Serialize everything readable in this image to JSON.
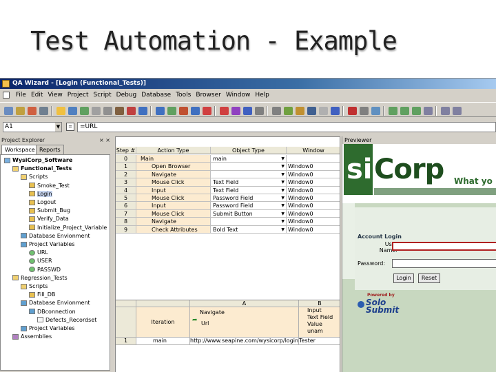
{
  "slide": {
    "title": "Test Automation - Example"
  },
  "window": {
    "title": "QA Wizard - [Login (Functional_Tests)]"
  },
  "menu": [
    "File",
    "Edit",
    "View",
    "Project",
    "Script",
    "Debug",
    "Database",
    "Tools",
    "Browser",
    "Window",
    "Help"
  ],
  "cellbar": {
    "cell_ref": "A1",
    "formula": "=URL",
    "fx": "=",
    "drop": "▼"
  },
  "explorer": {
    "title": "Project Explorer",
    "close": "× ×",
    "tabs": [
      "Workspace",
      "Reports"
    ],
    "nodes": [
      {
        "label": "WysiCorp_Software",
        "icon": "proj",
        "indent": 0,
        "bold": true
      },
      {
        "label": "Functional_Tests",
        "icon": "folder",
        "indent": 1,
        "bold": true
      },
      {
        "label": "Scripts",
        "icon": "folder",
        "indent": 2
      },
      {
        "label": "Smoke_Test",
        "icon": "script",
        "indent": 3
      },
      {
        "label": "Login",
        "icon": "script",
        "indent": 3,
        "selected": true
      },
      {
        "label": "Logout",
        "icon": "script",
        "indent": 3
      },
      {
        "label": "Submit_Bug",
        "icon": "script",
        "indent": 3
      },
      {
        "label": "Verify_Data",
        "icon": "script",
        "indent": 3
      },
      {
        "label": "Initialize_Project_Variable",
        "icon": "script",
        "indent": 3
      },
      {
        "label": "Database Envionment",
        "icon": "db",
        "indent": 2
      },
      {
        "label": "Project Variables",
        "icon": "db",
        "indent": 2
      },
      {
        "label": "URL",
        "icon": "var",
        "indent": 3
      },
      {
        "label": "USER",
        "icon": "var",
        "indent": 3
      },
      {
        "label": "PASSWD",
        "icon": "var",
        "indent": 3
      },
      {
        "label": "Regression_Tests",
        "icon": "folder",
        "indent": 1
      },
      {
        "label": "Scripts",
        "icon": "folder",
        "indent": 2
      },
      {
        "label": "Fill_DB",
        "icon": "script",
        "indent": 3
      },
      {
        "label": "Database Envionment",
        "icon": "db",
        "indent": 2
      },
      {
        "label": "DBconnection",
        "icon": "db",
        "indent": 3
      },
      {
        "label": "Defects_Recordset",
        "icon": "rs",
        "indent": 4
      },
      {
        "label": "Project Variables",
        "icon": "db",
        "indent": 2
      },
      {
        "label": "Assemblies",
        "icon": "asm",
        "indent": 1
      }
    ]
  },
  "steps": {
    "headers": [
      "Step #",
      "Action Type",
      "Object Type",
      "Window"
    ],
    "rows": [
      {
        "num": "0",
        "action": "Main",
        "object": "main",
        "window": ""
      },
      {
        "num": "1",
        "action": "Open Browser",
        "object": "",
        "window": "Window0"
      },
      {
        "num": "2",
        "action": "Navigate",
        "object": "",
        "window": "Window0"
      },
      {
        "num": "3",
        "action": "Mouse Click",
        "object": "Text Field",
        "window": "Window0"
      },
      {
        "num": "4",
        "action": "Input",
        "object": "Text Field",
        "window": "Window0"
      },
      {
        "num": "5",
        "action": "Mouse Click",
        "object": "Password Field",
        "window": "Window0"
      },
      {
        "num": "6",
        "action": "Input",
        "object": "Password Field",
        "window": "Window0"
      },
      {
        "num": "7",
        "action": "Mouse Click",
        "object": "Submit Button",
        "window": "Window0"
      },
      {
        "num": "8",
        "action": "Navigate",
        "object": "",
        "window": "Window0"
      },
      {
        "num": "9",
        "action": "Check Attributes",
        "object": "Bold Text",
        "window": "Window0"
      }
    ]
  },
  "datagrid": {
    "col_a": "A",
    "col_b": "B",
    "iteration": "Iteration",
    "a_sub1": "Navigate",
    "a_sub2": "Url",
    "b_sub1": "Input",
    "b_sub2": "Text Field",
    "b_sub3": "Value",
    "b_sub4": "unam",
    "row_num": "1",
    "row_iter": "main",
    "row_a": "http://www.seapine.com/wysicorp/login.",
    "row_b": "Tester"
  },
  "previewer": {
    "title": "Previewer",
    "logo_left": "si",
    "logo_main": "Corp",
    "tagline": "What yo",
    "login_title": "Account Login",
    "user_label": "User\nName:",
    "pass_label": "Password:",
    "login_btn": "Login",
    "reset_btn": "Reset",
    "powered": "Powered by",
    "solo": "Solo\nSubmit"
  },
  "colors": {
    "accent_title": "#0a246a",
    "logo_green": "#2e6b2e",
    "action_fill": "#fcebd0"
  }
}
